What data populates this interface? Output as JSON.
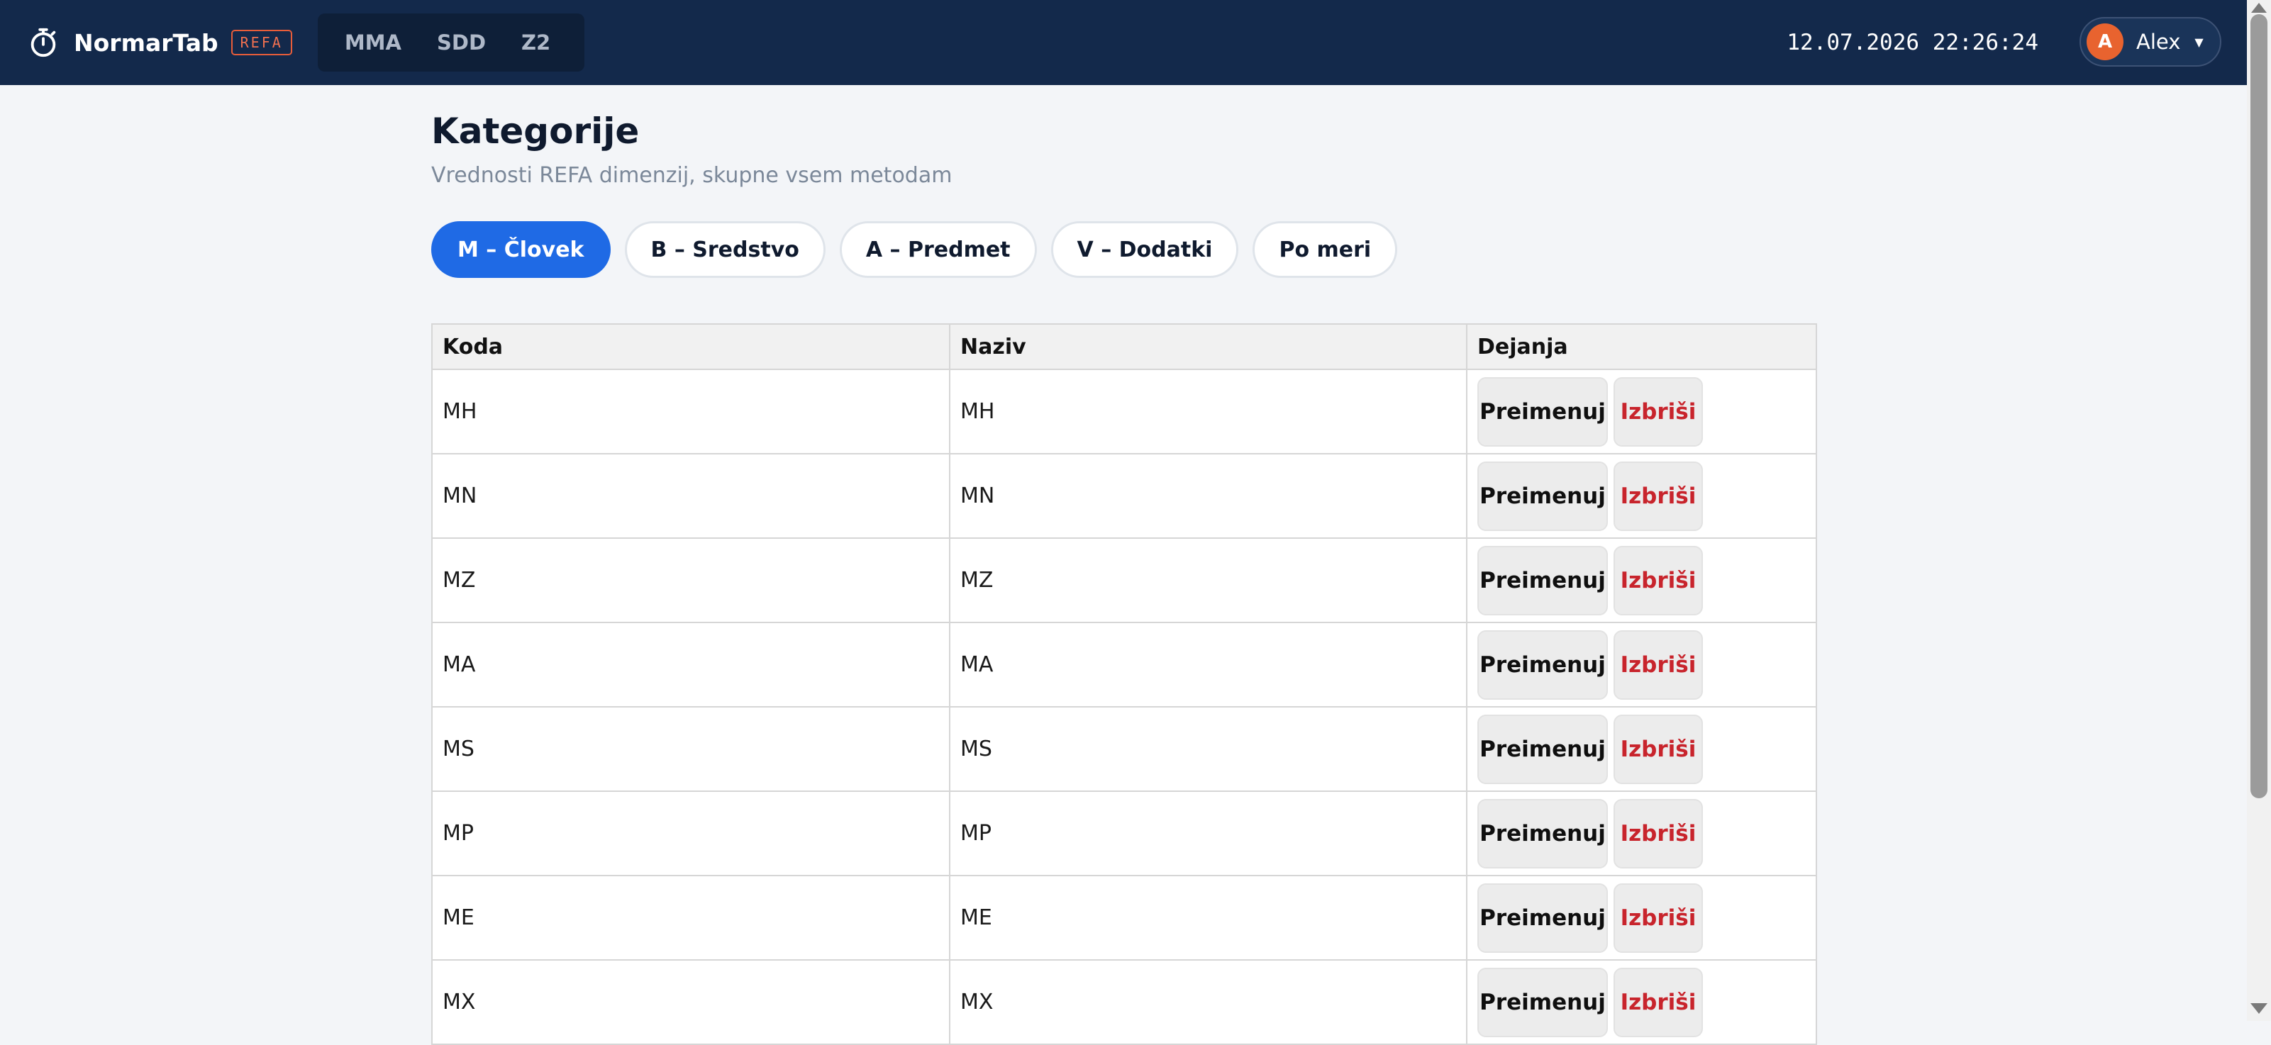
{
  "header": {
    "app_name": "NormarTab",
    "badge": "REFA",
    "nav": [
      {
        "label": "MMA"
      },
      {
        "label": "SDD"
      },
      {
        "label": "Z2"
      }
    ],
    "datetime": "12.07.2026 22:26:24",
    "user": {
      "initial": "A",
      "name": "Alex"
    }
  },
  "page": {
    "title": "Kategorije",
    "subtitle": "Vrednosti REFA dimenzij, skupne vsem metodam"
  },
  "tabs": [
    {
      "label": "M – Človek",
      "active": true
    },
    {
      "label": "B – Sredstvo",
      "active": false
    },
    {
      "label": "A – Predmet",
      "active": false
    },
    {
      "label": "V – Dodatki",
      "active": false
    },
    {
      "label": "Po meri",
      "active": false
    }
  ],
  "table": {
    "columns": [
      "Koda",
      "Naziv",
      "Dejanja"
    ],
    "rename_label": "Preimenuj",
    "delete_label": "Izbriši",
    "rows": [
      {
        "code": "MH",
        "name": "MH"
      },
      {
        "code": "MN",
        "name": "MN"
      },
      {
        "code": "MZ",
        "name": "MZ"
      },
      {
        "code": "MA",
        "name": "MA"
      },
      {
        "code": "MS",
        "name": "MS"
      },
      {
        "code": "MP",
        "name": "MP"
      },
      {
        "code": "ME",
        "name": "ME"
      },
      {
        "code": "MX",
        "name": "MX"
      }
    ]
  },
  "colors": {
    "topbar": "#13294b",
    "accent": "#1f6ae5",
    "avatar": "#e8632f",
    "danger": "#c8242c"
  },
  "icons": {
    "brand": "stopwatch-icon",
    "user_menu": "caret-down-icon"
  }
}
